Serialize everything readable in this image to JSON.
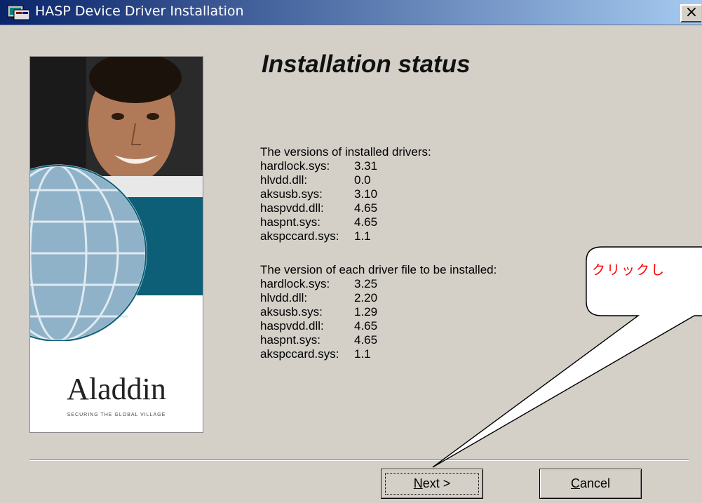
{
  "window": {
    "title": "HASP Device Driver Installation",
    "close_glyph": "×"
  },
  "heading": "Installation status",
  "installed": {
    "label": "The versions of installed drivers:",
    "drivers": [
      {
        "name": "hardlock.sys:",
        "version": "3.31"
      },
      {
        "name": "hlvdd.dll:",
        "version": "0.0"
      },
      {
        "name": "aksusb.sys:",
        "version": "3.10"
      },
      {
        "name": "haspvdd.dll:",
        "version": "4.65"
      },
      {
        "name": "haspnt.sys:",
        "version": "4.65"
      },
      {
        "name": "akspccard.sys:",
        "version": "1.1"
      }
    ]
  },
  "to_install": {
    "label": "The version of each driver file to be installed:",
    "drivers": [
      {
        "name": "hardlock.sys:",
        "version": "3.25"
      },
      {
        "name": "hlvdd.dll:",
        "version": "2.20"
      },
      {
        "name": "aksusb.sys:",
        "version": "1.29"
      },
      {
        "name": "haspvdd.dll:",
        "version": "4.65"
      },
      {
        "name": "haspnt.sys:",
        "version": "4.65"
      },
      {
        "name": "akspccard.sys:",
        "version": "1.1"
      }
    ]
  },
  "branding": {
    "logo_text": "Aladdin",
    "tagline": "SECURING THE GLOBAL VILLAGE"
  },
  "buttons": {
    "next_accel": "N",
    "next_rest": "ext >",
    "cancel_accel": "C",
    "cancel_rest": "ancel"
  },
  "annotation": {
    "text": "クリックし"
  },
  "colors": {
    "titlebar_start": "#0a246a",
    "titlebar_end": "#a6caf0",
    "dialog_bg": "#d4d0c8",
    "annotation": "#ff0000",
    "panel_teal": "#0d5f78"
  }
}
